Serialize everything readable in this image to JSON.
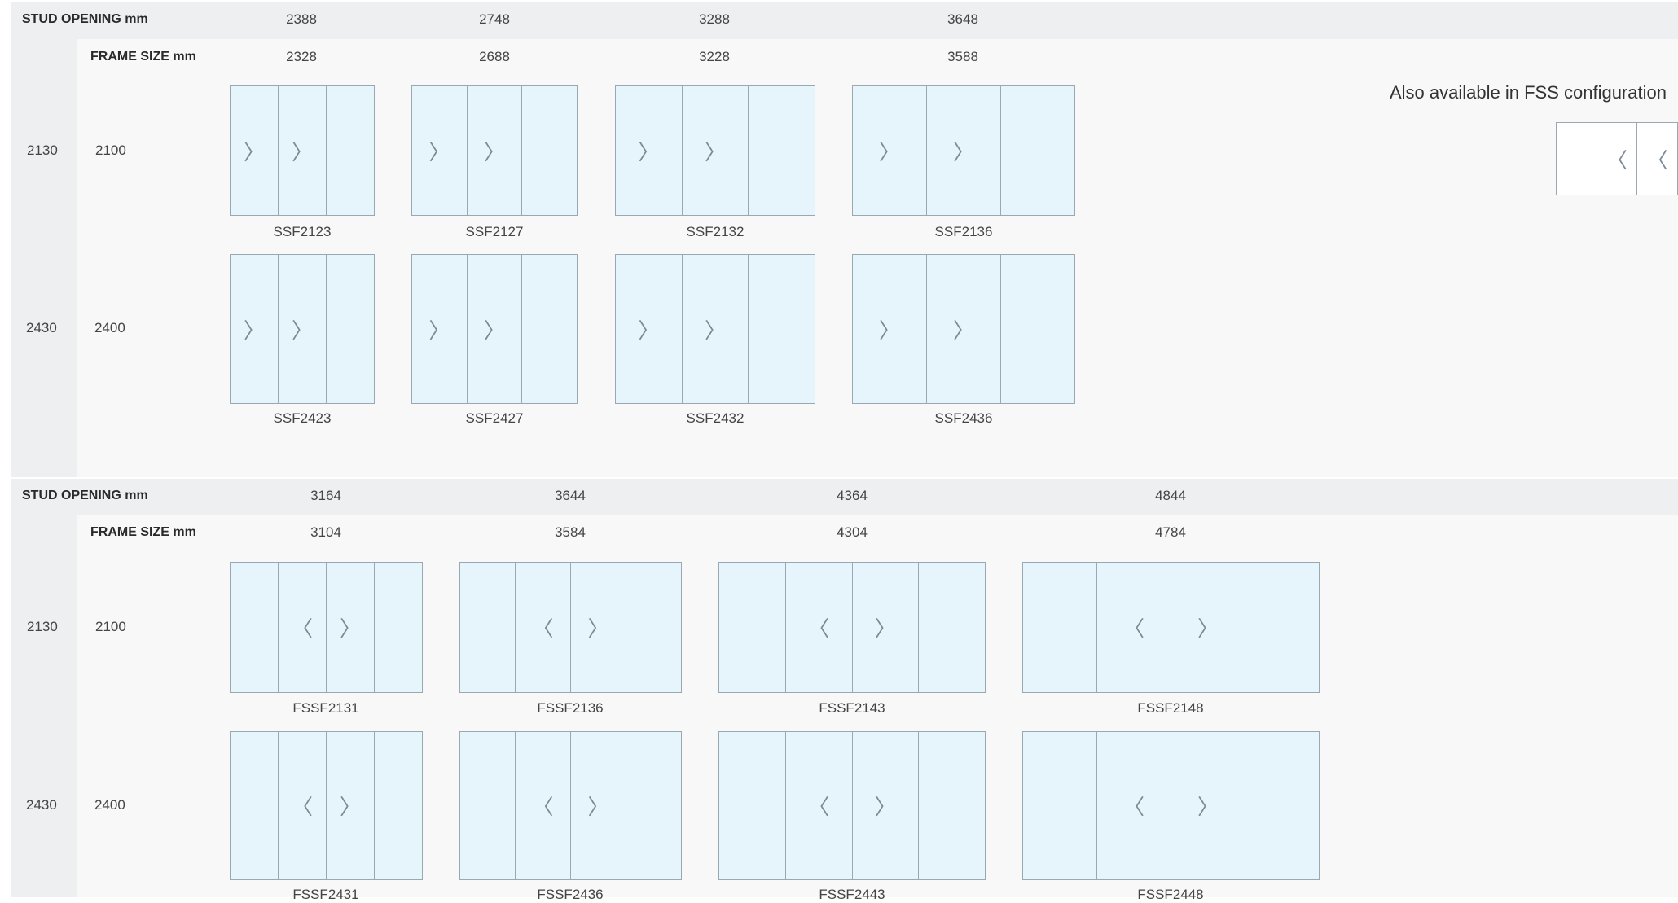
{
  "sections": [
    {
      "stud_label": "STUD OPENING mm",
      "frame_label": "FRAME SIZE mm",
      "stud_values": [
        "2388",
        "2748",
        "3288",
        "3648"
      ],
      "frame_values": [
        "2328",
        "2688",
        "3228",
        "3588"
      ],
      "rows": [
        {
          "stud": "2130",
          "frame": "2100",
          "doors": [
            {
              "code": "SSF2123",
              "panes": [
                "〉",
                "〉",
                ""
              ]
            },
            {
              "code": "SSF2127",
              "panes": [
                "〉",
                "〉",
                ""
              ]
            },
            {
              "code": "SSF2132",
              "panes": [
                "〉",
                "〉",
                ""
              ]
            },
            {
              "code": "SSF2136",
              "panes": [
                "〉",
                "〉",
                ""
              ]
            }
          ]
        },
        {
          "stud": "2430",
          "frame": "2400",
          "doors": [
            {
              "code": "SSF2423",
              "panes": [
                "〉",
                "〉",
                ""
              ]
            },
            {
              "code": "SSF2427",
              "panes": [
                "〉",
                "〉",
                ""
              ]
            },
            {
              "code": "SSF2432",
              "panes": [
                "〉",
                "〉",
                ""
              ]
            },
            {
              "code": "SSF2436",
              "panes": [
                "〉",
                "〉",
                ""
              ]
            }
          ]
        }
      ]
    },
    {
      "stud_label": "STUD OPENING mm",
      "frame_label": "FRAME SIZE mm",
      "stud_values": [
        "3164",
        "3644",
        "4364",
        "4844"
      ],
      "frame_values": [
        "3104",
        "3584",
        "4304",
        "4784"
      ],
      "rows": [
        {
          "stud": "2130",
          "frame": "2100",
          "doors": [
            {
              "code": "FSSF2131",
              "panes": [
                "",
                "〈",
                "〉",
                ""
              ]
            },
            {
              "code": "FSSF2136",
              "panes": [
                "",
                "〈",
                "〉",
                ""
              ]
            },
            {
              "code": "FSSF2143",
              "panes": [
                "",
                "〈",
                "〉",
                ""
              ]
            },
            {
              "code": "FSSF2148",
              "panes": [
                "",
                "〈",
                "〉",
                ""
              ]
            }
          ]
        },
        {
          "stud": "2430",
          "frame": "2400",
          "doors": [
            {
              "code": "FSSF2431",
              "panes": [
                "",
                "〈",
                "〉",
                ""
              ]
            },
            {
              "code": "FSSF2436",
              "panes": [
                "",
                "〈",
                "〉",
                ""
              ]
            },
            {
              "code": "FSSF2443",
              "panes": [
                "",
                "〈",
                "〉",
                ""
              ]
            },
            {
              "code": "FSSF2448",
              "panes": [
                "",
                "〈",
                "〉",
                ""
              ]
            }
          ]
        }
      ]
    }
  ],
  "fss_note": {
    "text": "Also available in FSS configuration",
    "panes": [
      "",
      "〈",
      "〈"
    ]
  }
}
